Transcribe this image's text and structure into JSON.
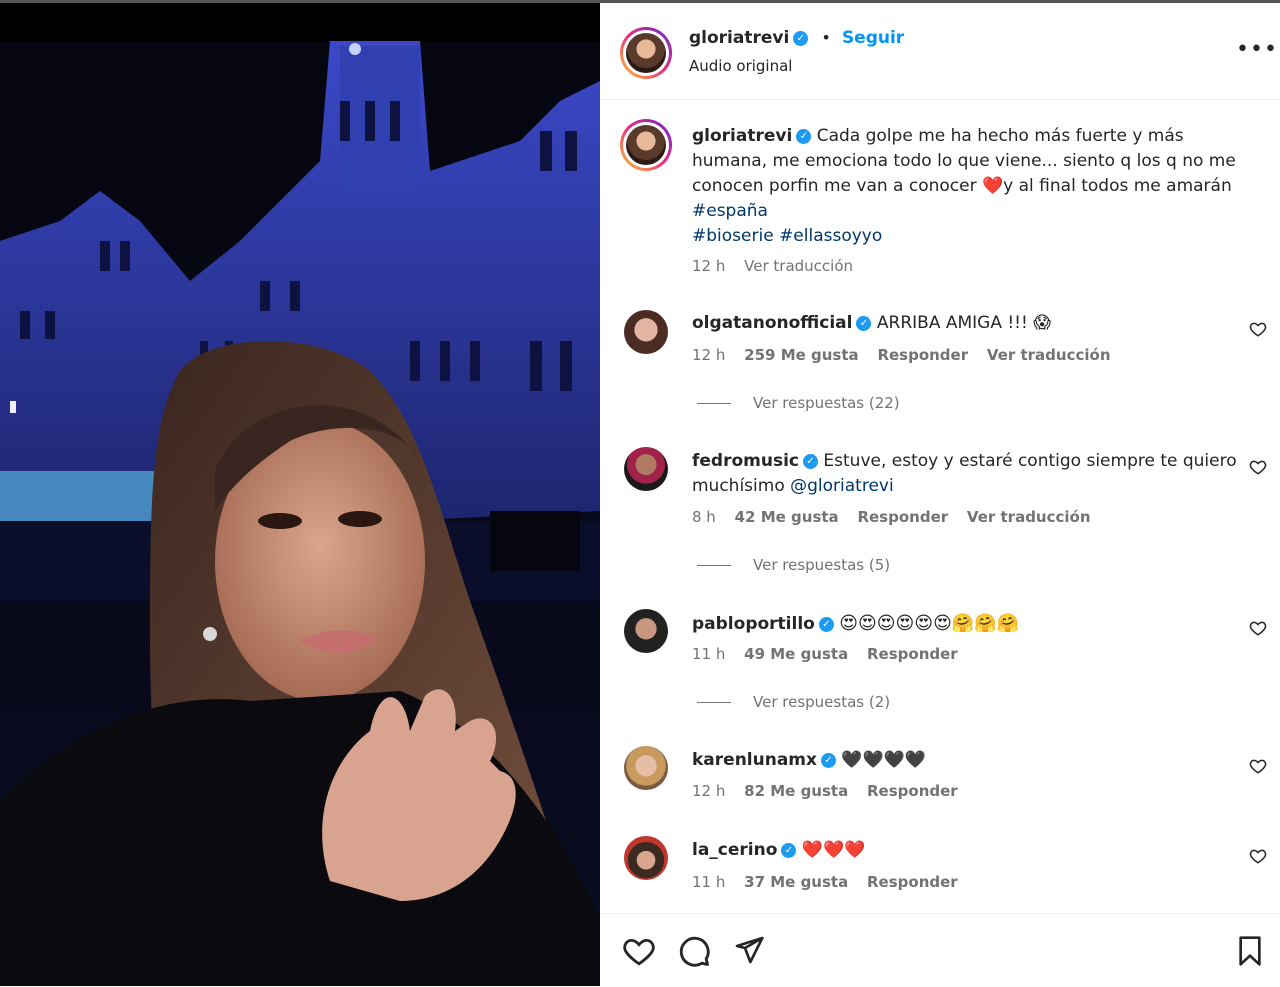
{
  "post": {
    "username": "gloriatrevi",
    "follow_label": "Seguir",
    "audio_label": "Audio original",
    "more_icon": "more-dots-icon",
    "caption_text": "Cada golpe me ha hecho más fuerte y más humana, me emociona todo lo que viene... siento q los q no me conocen porfin me van a conocer",
    "caption_emoji": "❤️",
    "caption_text2": "y al final todos me amarán",
    "hashtag1": "#españa",
    "hashtag2": "#bioserie",
    "hashtag3": "#ellassoyyo",
    "caption_time": "12 h",
    "caption_translate": "Ver traducción"
  },
  "comments": [
    {
      "username": "olgatanonofficial",
      "text": "ARRIBA AMIGA !!! 😱",
      "time": "12 h",
      "likes": "259 Me gusta",
      "reply": "Responder",
      "translate": "Ver traducción",
      "replies": "Ver respuestas (22)"
    },
    {
      "username": "fedromusic",
      "text": "Estuve, estoy y estaré contigo siempre te quiero muchísimo",
      "mention": "@gloriatrevi",
      "time": "8 h",
      "likes": "42 Me gusta",
      "reply": "Responder",
      "translate": "Ver traducción",
      "replies": "Ver respuestas (5)"
    },
    {
      "username": "pabloportillo",
      "text": "😍😍😍😍😍😍🤗🤗🤗",
      "time": "11 h",
      "likes": "49 Me gusta",
      "reply": "Responder",
      "replies": "Ver respuestas (2)"
    },
    {
      "username": "karenlunamx",
      "text": "🖤🖤🖤🖤",
      "time": "12 h",
      "likes": "82 Me gusta",
      "reply": "Responder"
    },
    {
      "username": "la_cerino",
      "text": "❤️❤️❤️",
      "time": "11 h",
      "likes": "37 Me gusta",
      "reply": "Responder"
    }
  ],
  "colors": {
    "accent_blue": "#0095f6",
    "verified": "#1d9bf0",
    "muted": "#737373",
    "link": "#00376b"
  }
}
